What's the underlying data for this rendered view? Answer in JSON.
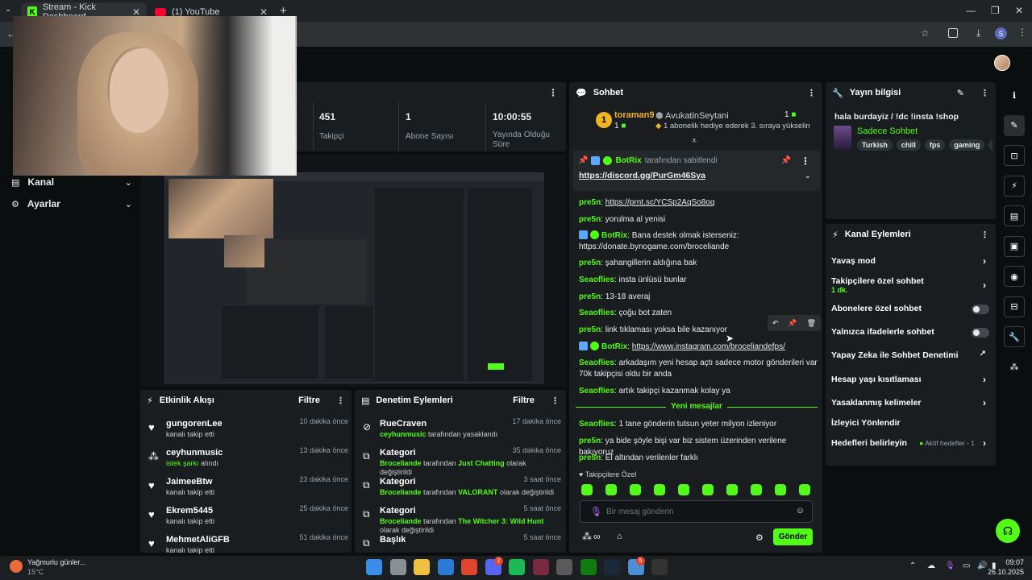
{
  "browser": {
    "tabs": [
      {
        "title": "Stream - Kick Dashboard",
        "active": true
      },
      {
        "title": "(1) YouTube",
        "active": false
      }
    ],
    "profile_initial": "S"
  },
  "sidebar": {
    "items": [
      {
        "label": "Kanal"
      },
      {
        "label": "Ayarlar"
      }
    ]
  },
  "stats": [
    {
      "value": "451",
      "label": "Takipçi"
    },
    {
      "value": "1",
      "label": "Abone Sayısı"
    },
    {
      "value": "10:00:55",
      "label": "Yayında Olduğu Süre"
    }
  ],
  "activity_feed": {
    "title": "Etkinlik Akışı",
    "filter_label": "Filtre",
    "items": [
      {
        "icon": "heart-icon",
        "name": "gungorenLee",
        "sub": "kanalı takip etti",
        "time": "10 dakika önce"
      },
      {
        "icon": "music-icon",
        "name": "ceyhunmusic",
        "sub_green": "istek şarkı",
        "sub": "alındı",
        "time": "13 dakika önce"
      },
      {
        "icon": "heart-icon",
        "name": "JaimeeBtw",
        "sub": "kanalı takip etti",
        "time": "23 dakika önce"
      },
      {
        "icon": "heart-icon",
        "name": "Ekrem5445",
        "sub": "kanalı takip etti",
        "time": "25 dakika önce"
      },
      {
        "icon": "heart-icon",
        "name": "MehmetAliGFB",
        "sub": "kanalı takip etti",
        "time": "51 dakika önce"
      }
    ]
  },
  "moderation_feed": {
    "title": "Denetim Eylemleri",
    "filter_label": "Filtre",
    "items": [
      {
        "name": "RueCraven",
        "actor": "ceyhunmusic",
        "sub": "tarafından yasaklandı",
        "time": "17 dakika önce"
      },
      {
        "name": "Kategori",
        "actor": "Broceliande",
        "sub": "tarafından",
        "target": "Just Chatting",
        "sub2": "olarak değiştirildi",
        "time": "35 dakika önce"
      },
      {
        "name": "Kategori",
        "actor": "Broceliande",
        "sub": "tarafından",
        "target": "VALORANT",
        "sub2": "olarak değiştirildi",
        "time": "3 saat önce"
      },
      {
        "name": "Kategori",
        "actor": "Broceliande",
        "sub": "tarafından",
        "target": "The Witcher 3: Wild Hunt",
        "sub2": "olarak değiştirildi",
        "time": "5 saat önce"
      },
      {
        "name": "Başlık",
        "time": "5 saat önce"
      }
    ]
  },
  "chat": {
    "title": "Sohbet",
    "top_gifter": {
      "name": "toraman9",
      "rank": "1",
      "count": "1"
    },
    "second": {
      "name": "AvukatinSeytani",
      "note": "1 abonelik hediye ederek 3. sıraya yükselin",
      "count": "1"
    },
    "pinned": {
      "by": "BotRix",
      "by_suffix": "tarafından sabitlendi",
      "link": "https://discord.gg/PurGm46Sya"
    },
    "messages": [
      {
        "user": "pre5n",
        "text": "https://prnt.sc/YCSp2AqSo8oq",
        "is_link": true
      },
      {
        "user": "pre5n",
        "text": "yorulma al yenisi"
      },
      {
        "user": "BotRix",
        "text": "Bana destek olmak isterseniz: https://donate.bynogame.com/broceliande",
        "bot": true
      },
      {
        "user": "pre5n",
        "text": "şahangillerin aldığına bak"
      },
      {
        "user": "Seaoflies",
        "text": "insta ünlüsü bunlar"
      },
      {
        "user": "pre5n",
        "text": "13-18 averaj"
      },
      {
        "user": "Seaoflies",
        "text": "çoğu bot zaten"
      },
      {
        "user": "pre5n",
        "text": "link tıklaması yoksa bile kazanıyor"
      },
      {
        "user": "BotRix",
        "text": "https://www.instagram.com/broceliandefps/",
        "bot": true,
        "is_link": true
      },
      {
        "user": "Seaoflies",
        "text": "arkadaşım yeni hesap açtı sadece motor gönderileri var 70k takipçisi oldu bir anda"
      },
      {
        "user": "Seaoflies",
        "text": "artık takipçi kazanmak kolay ya"
      }
    ],
    "new_messages_label": "Yeni mesajlar",
    "new_messages": [
      {
        "user": "Seaoflies",
        "text": "1 tane gönderin tutsun yeter milyon izleniyor"
      },
      {
        "user": "pre5n",
        "text": "ya bide şöyle bişi var biz sistem üzerinden verilene bakıyoruz"
      },
      {
        "user": "pre5n",
        "text": "El altından verilenler farklı"
      }
    ],
    "followers_only_label": "Takipçilere Özel",
    "input_placeholder": "Bir mesaj gönderin",
    "send_label": "Gönder",
    "infinity": "∞"
  },
  "stream_info": {
    "title": "Yayın bilgisi",
    "stream_title": "hala burdayiz / !dc !insta !shop",
    "category": "Sadece Sohbet",
    "tags": [
      "Turkish",
      "chill",
      "fps",
      "gaming",
      "va"
    ]
  },
  "channel_actions": {
    "title": "Kanal Eylemleri",
    "items": [
      {
        "label": "Yavaş mod",
        "control": "chevron"
      },
      {
        "label": "Takipçilere özel sohbet",
        "sub": "1 dk.",
        "control": "chevron"
      },
      {
        "label": "Abonelere özel sohbet",
        "control": "toggle"
      },
      {
        "label": "Yalnızca ifadelerle sohbet",
        "control": "toggle"
      },
      {
        "label": "Yapay Zeka ile Sohbet Denetimi",
        "control": "external"
      },
      {
        "label": "Hesap yaşı kısıtlaması",
        "control": "chevron"
      },
      {
        "label": "Yasaklanmış kelimeler",
        "control": "chevron"
      },
      {
        "label": "İzleyici Yönlendir",
        "control": "none"
      },
      {
        "label": "Hedefleri belirleyin",
        "badge": "Aktif hedefler - 1",
        "control": "chevron"
      }
    ]
  },
  "taskbar": {
    "weather": "Yağmurlu günler...",
    "temp": "15°C",
    "time": "09:07",
    "date": "26.10.2025",
    "badge_discord": "2",
    "badge_chrome": "5"
  },
  "colors": {
    "accent": "#53fc18",
    "panel": "#1a1d1f",
    "bg": "#0b0e0f"
  }
}
